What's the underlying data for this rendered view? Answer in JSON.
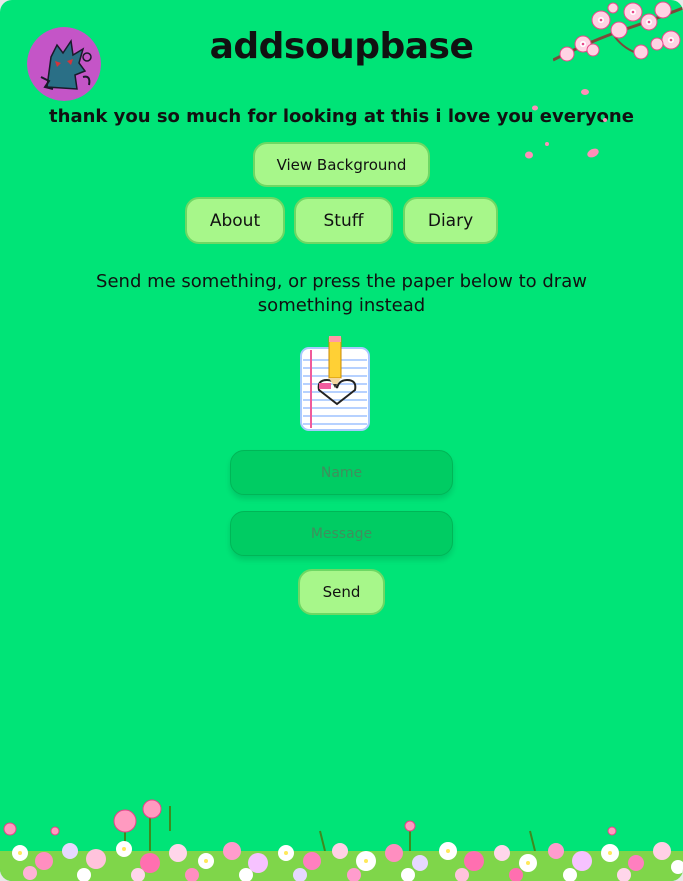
{
  "site": {
    "title": "addsoupbase",
    "tagline": "thank you so much for looking at this i love you everyone"
  },
  "buttons": {
    "view_background": "View Background",
    "about": "About",
    "stuff": "Stuff",
    "diary": "Diary",
    "send": "Send"
  },
  "form": {
    "prompt": "Send me something, or press the paper below to draw something instead",
    "name_placeholder": "Name",
    "message_placeholder": "Message"
  },
  "icons": {
    "avatar": "character-avatar-icon",
    "paper": "drawing-paper-icon",
    "blossoms": "cherry-blossom-icon",
    "garden": "flower-garden-icon"
  },
  "colors": {
    "background": "#00e477",
    "button": "#a7f78a",
    "button_border": "#6ed864",
    "field": "#00cc63",
    "avatar_ring": "#c455c7"
  }
}
